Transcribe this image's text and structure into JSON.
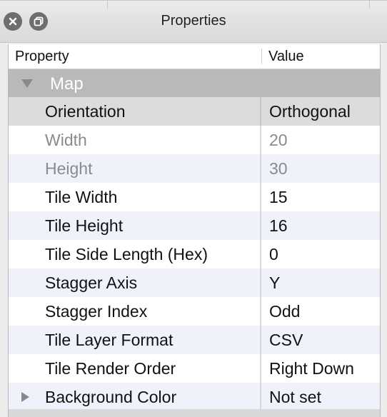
{
  "window": {
    "title": "Properties",
    "close_icon": "close-icon",
    "float_icon": "float-window-icon"
  },
  "table": {
    "headers": {
      "property": "Property",
      "value": "Value"
    },
    "group": {
      "label": "Map",
      "expanded": true
    },
    "rows": [
      {
        "name": "Orientation",
        "value": "Orthogonal",
        "state": "selected"
      },
      {
        "name": "Width",
        "value": "20",
        "state": "disabled"
      },
      {
        "name": "Height",
        "value": "30",
        "state": "disabled"
      },
      {
        "name": "Tile Width",
        "value": "15",
        "state": "normal"
      },
      {
        "name": "Tile Height",
        "value": "16",
        "state": "normal"
      },
      {
        "name": "Tile Side Length (Hex)",
        "value": "0",
        "state": "normal"
      },
      {
        "name": "Stagger Axis",
        "value": "Y",
        "state": "normal"
      },
      {
        "name": "Stagger Index",
        "value": "Odd",
        "state": "normal"
      },
      {
        "name": "Tile Layer Format",
        "value": "CSV",
        "state": "normal"
      },
      {
        "name": "Tile Render Order",
        "value": "Right Down",
        "state": "normal"
      },
      {
        "name": "Background Color",
        "value": "Not set",
        "state": "collapsed"
      }
    ]
  },
  "colors": {
    "group_header": "#b9b9b9",
    "alt_row": "#eff2fb",
    "selected_row": "#dcdcdc",
    "disabled_text": "#8a8a8a"
  }
}
